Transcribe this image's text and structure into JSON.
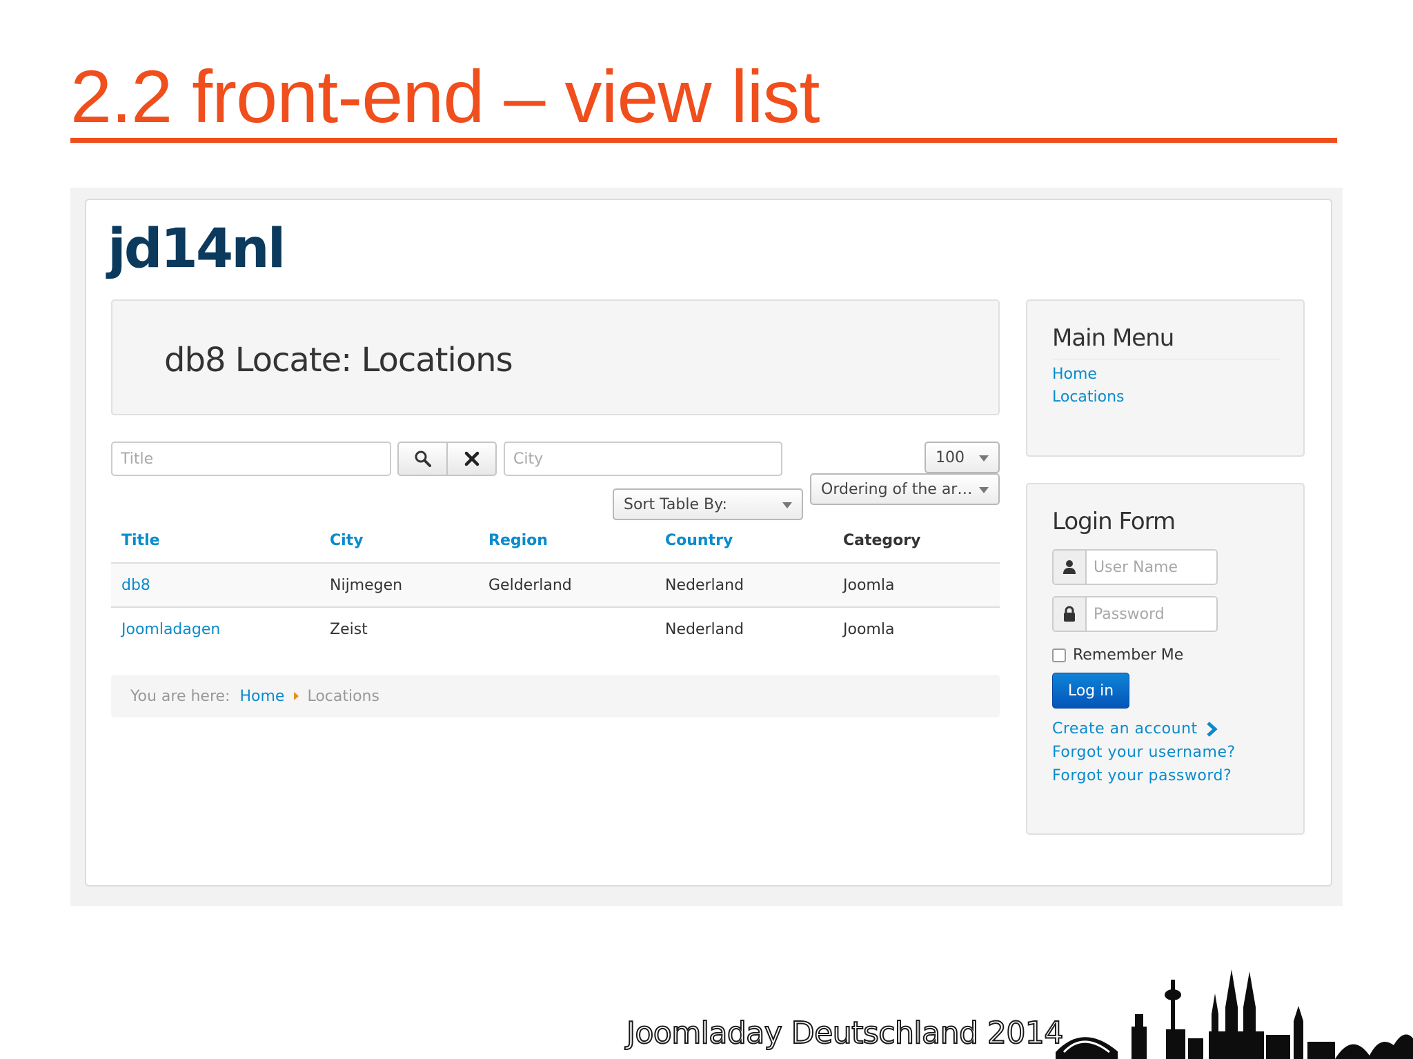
{
  "slide": {
    "title": "2.2 front-end – view list",
    "footer": "Joomladay Deutschland 2014"
  },
  "site": {
    "brand": "jd14nl",
    "page_heading": "db8 Locate: Locations"
  },
  "filters": {
    "title_placeholder": "Title",
    "city_placeholder": "City",
    "search_icon": "search-icon",
    "clear_icon": "close-icon",
    "limit_value": "100",
    "ordering_value": "Ordering of the ar…",
    "sort_value": "Sort Table By:"
  },
  "table": {
    "headers": [
      "Title",
      "City",
      "Region",
      "Country",
      "Category"
    ],
    "rows": [
      {
        "title": "db8",
        "city": "Nijmegen",
        "region": "Gelderland",
        "country": "Nederland",
        "category": "Joomla"
      },
      {
        "title": "Joomladagen",
        "city": "Zeist",
        "region": "",
        "country": "Nederland",
        "category": "Joomla"
      }
    ]
  },
  "breadcrumb": {
    "prefix": "You are here:",
    "home": "Home",
    "current": "Locations"
  },
  "main_menu": {
    "title": "Main Menu",
    "items": [
      "Home",
      "Locations"
    ]
  },
  "login": {
    "title": "Login Form",
    "username_placeholder": "User Name",
    "password_placeholder": "Password",
    "remember_label": "Remember Me",
    "button_label": "Log in",
    "create_account": "Create an account",
    "forgot_username": "Forgot your username?",
    "forgot_password": "Forgot your password?"
  },
  "colors": {
    "accent": "#f04e1c",
    "link": "#0a8bcc",
    "brand": "#0b3a5c",
    "button": "#0455b8"
  }
}
